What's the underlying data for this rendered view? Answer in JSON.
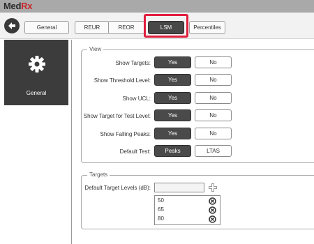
{
  "app": {
    "logo_main": "Med",
    "logo_accent": "Rx"
  },
  "tabs": [
    {
      "label": "General",
      "active": false
    },
    {
      "label": "REUR",
      "active": false
    },
    {
      "label": "REOR",
      "active": false
    },
    {
      "label": "LSM",
      "active": true
    },
    {
      "label": "Percentiles",
      "active": false
    }
  ],
  "sidebar": {
    "general_label": "General"
  },
  "view": {
    "title": "View",
    "rows": [
      {
        "label": "Show Targets:",
        "option_a": "Yes",
        "option_b": "No",
        "selected": "a"
      },
      {
        "label": "Show Threshold Level:",
        "option_a": "Yes",
        "option_b": "No",
        "selected": "a"
      },
      {
        "label": "Show UCL:",
        "option_a": "Yes",
        "option_b": "No",
        "selected": "a"
      },
      {
        "label": "Show Target for Test Level:",
        "option_a": "Yes",
        "option_b": "No",
        "selected": "a"
      },
      {
        "label": "Show Falling Peaks:",
        "option_a": "Yes",
        "option_b": "No",
        "selected": "a"
      },
      {
        "label": "Default Test:",
        "option_a": "Peaks",
        "option_b": "LTAS",
        "selected": "a"
      }
    ]
  },
  "targets": {
    "title": "Targets",
    "default_label": "Default Target Levels (dB):",
    "input_value": "",
    "levels": [
      "50",
      "65",
      "80"
    ]
  },
  "colors": {
    "accent": "#e01f3d",
    "brand_red": "#c8252c",
    "selected_button": "#4a4a4a"
  },
  "icons": [
    "back-arrow-icon",
    "gear-icon",
    "plus-icon",
    "remove-icon"
  ]
}
